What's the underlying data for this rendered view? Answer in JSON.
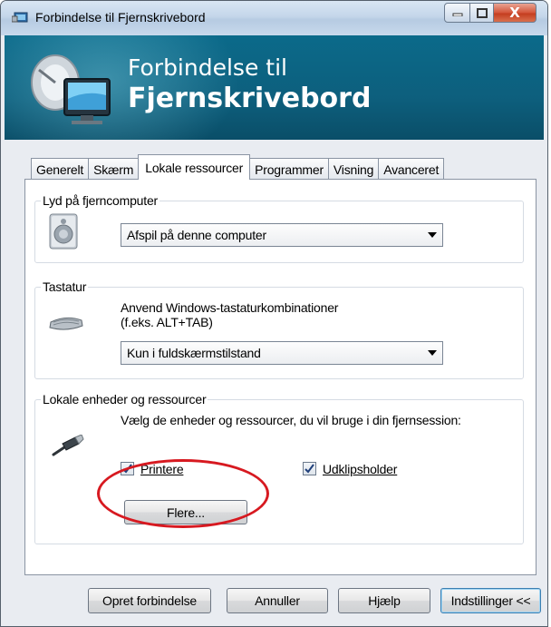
{
  "window": {
    "title": "Forbindelse til Fjernskrivebord",
    "minimize_label": "",
    "maximize_label": "",
    "close_label": "X"
  },
  "banner": {
    "line1": "Forbindelse til",
    "line2": "Fjernskrivebord"
  },
  "tabs": [
    "Generelt",
    "Skærm",
    "Lokale ressourcer",
    "Programmer",
    "Visning",
    "Avanceret"
  ],
  "active_tab": "Lokale ressourcer",
  "audio": {
    "legend": "Lyd på fjerncomputer",
    "selected": "Afspil på denne computer"
  },
  "keyboard": {
    "legend": "Tastatur",
    "description_line1": "Anvend Windows-tastaturkombinationer",
    "description_line2": "(f.eks. ALT+TAB)",
    "selected": "Kun i fuldskærmstilstand"
  },
  "local_devices": {
    "legend": "Lokale enheder og ressourcer",
    "description": "Vælg de enheder og ressourcer, du vil bruge i din fjernsession:",
    "printers_label": "Printere",
    "printers_checked": true,
    "clipboard_label": "Udklipsholder",
    "clipboard_checked": true,
    "more_button": "Flere..."
  },
  "buttons": {
    "connect": "Opret forbindelse",
    "cancel": "Annuller",
    "help": "Hjælp",
    "options": "Indstillinger <<"
  },
  "colors": {
    "banner": "#0d5f7d",
    "highlight_ellipse": "#d71920",
    "close_button": "#c43d1f"
  }
}
